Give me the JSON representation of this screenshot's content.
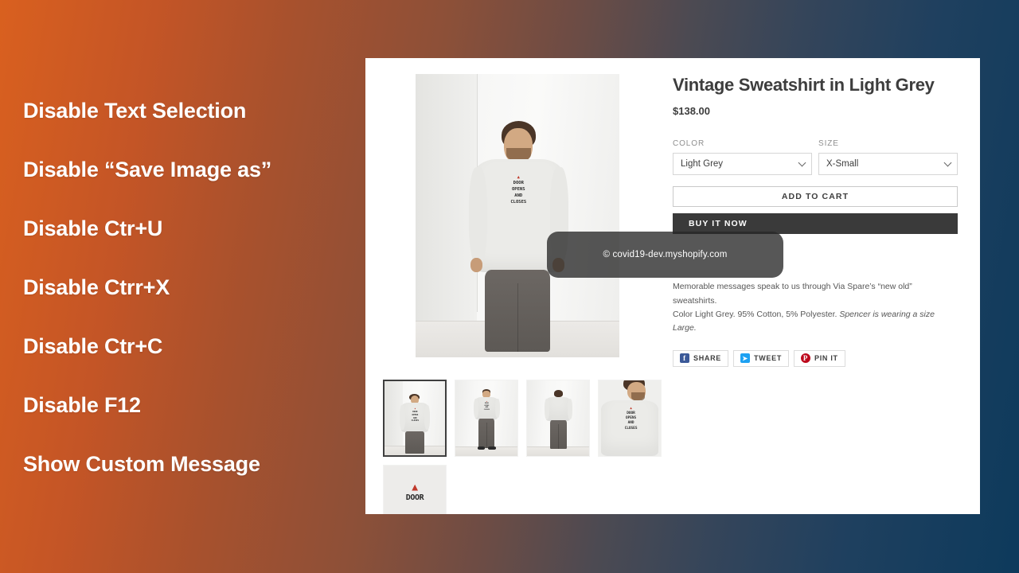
{
  "background": {
    "gradient_from": "#d9601f",
    "gradient_to": "#0d3a5c"
  },
  "features": {
    "items": [
      {
        "label": "Disable Text Selection"
      },
      {
        "label": "Disable “Save Image as”"
      },
      {
        "label": "Disable Ctr+U"
      },
      {
        "label": "Disable Ctrr+X"
      },
      {
        "label": "Disable Ctr+C"
      },
      {
        "label": "Disable F12"
      },
      {
        "label": "Show Custom Message"
      }
    ]
  },
  "product": {
    "title": "Vintage Sweatshirt in Light Grey",
    "price": "$138.00",
    "description_line1": "Memorable messages speak to us through Via Spare’s “new old” sweatshirts.",
    "description_line2_plain": "Color Light Grey. 95% Cotton, 5% Polyester. ",
    "description_line2_italic": "Spencer is wearing a size Large.",
    "print_mark": "▲",
    "print_line1": "DOOR",
    "print_line2": "OPENS",
    "print_line3": "AND",
    "print_line4": "CLOSES"
  },
  "options": {
    "color": {
      "label": "COLOR",
      "value": "Light Grey",
      "icon": "chevron-down-icon"
    },
    "size": {
      "label": "SIZE",
      "value": "X-Small",
      "icon": "chevron-down-icon"
    }
  },
  "actions": {
    "add_to_cart": "ADD TO CART",
    "buy_it_now": "BUY IT NOW"
  },
  "share": {
    "buttons": [
      {
        "label": "SHARE",
        "icon": "facebook-icon",
        "glyph": "f",
        "color": "#3b5998"
      },
      {
        "label": "TWEET",
        "icon": "twitter-icon",
        "glyph": "ᴠ",
        "color": "#1da1f2"
      },
      {
        "label": "PIN IT",
        "icon": "pinterest-icon",
        "glyph": "P",
        "color": "#bd081c"
      }
    ]
  },
  "overlay": {
    "message": "© covid19-dev.myshopify.com"
  },
  "gallery": {
    "thumbnails": [
      {
        "name": "thumbnail-front-view",
        "selected": true
      },
      {
        "name": "thumbnail-full-body",
        "selected": false
      },
      {
        "name": "thumbnail-back-view",
        "selected": false
      },
      {
        "name": "thumbnail-chest-detail",
        "selected": false
      },
      {
        "name": "thumbnail-print-closeup",
        "selected": false
      }
    ]
  }
}
